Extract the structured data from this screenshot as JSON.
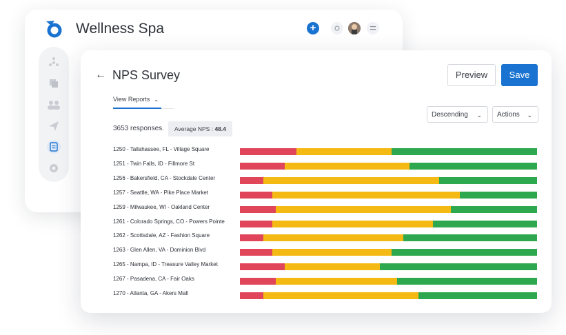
{
  "app": {
    "title": "Wellness Spa"
  },
  "topbar": {
    "icons": [
      "plus-icon",
      "help-icon",
      "avatar",
      "menu-icon"
    ]
  },
  "sidebar": {
    "icons": [
      "network-icon",
      "copy-icon",
      "users-icon",
      "send-icon",
      "document-icon",
      "gear-icon"
    ],
    "active": "document-icon"
  },
  "page": {
    "title": "NPS Survey",
    "preview_label": "Preview",
    "save_label": "Save",
    "tab_label": "View Reports",
    "sort_label": "Descending",
    "actions_label": "Actions",
    "responses_text": "3653 responses.",
    "avg_label": "Average NPS :",
    "avg_value": "48.4"
  },
  "colors": {
    "accent": "#1a73d1",
    "detractor": "#e0455a",
    "passive": "#f5b914",
    "promoter": "#2ea84e"
  },
  "locations": [
    {
      "label": "1250 - Tallahassee, FL - Village Square",
      "detractors": 19,
      "passives": 32,
      "promoters": 49
    },
    {
      "label": "1251 - Twin Falls, ID - Fillmore St",
      "detractors": 15,
      "passives": 42,
      "promoters": 43
    },
    {
      "label": "1256 - Bakersfield, CA - Stockdale Center",
      "detractors": 8,
      "passives": 59,
      "promoters": 33
    },
    {
      "label": "1257 - Seattle, WA - Pike Place Market",
      "detractors": 11,
      "passives": 63,
      "promoters": 26
    },
    {
      "label": "1259 - Milwaukee, WI - Oakland Center",
      "detractors": 12,
      "passives": 59,
      "promoters": 29
    },
    {
      "label": "1261 - Colorado Springs, CO - Powers Pointe",
      "detractors": 11,
      "passives": 54,
      "promoters": 35
    },
    {
      "label": "1262 - Scottsdale, AZ - Fashion Square",
      "detractors": 8,
      "passives": 47,
      "promoters": 45
    },
    {
      "label": "1263 - Glen Allen, VA - Dominion Blvd",
      "detractors": 11,
      "passives": 40,
      "promoters": 49
    },
    {
      "label": "1265 - Nampa, ID - Treasure Valley Market",
      "detractors": 15,
      "passives": 32,
      "promoters": 53
    },
    {
      "label": "1267 - Pasadena, CA - Fair Oaks",
      "detractors": 12,
      "passives": 41,
      "promoters": 47
    },
    {
      "label": "1270 - Atlanta, GA - Akers Mall",
      "detractors": 8,
      "passives": 52,
      "promoters": 40
    }
  ]
}
